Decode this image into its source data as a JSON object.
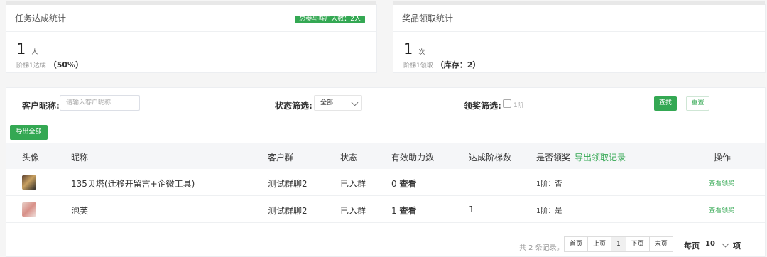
{
  "task_card": {
    "title": "任务达成统计",
    "badge": "总参与客户人数：2人",
    "count": "1",
    "unit": "人",
    "sub_label": "阶梯1达成",
    "sub_value": "（50%）"
  },
  "reward_card": {
    "title": "奖品领取统计",
    "count": "1",
    "unit": "次",
    "sub_label": "阶梯1领取",
    "sub_value": "（库存：2）"
  },
  "filters": {
    "nickname_label": "客户昵称:",
    "nickname_placeholder": "请输入客户昵称",
    "status_label": "状态筛选:",
    "status_value": "全部",
    "reward_label": "领奖筛选:",
    "reward_option": "1阶",
    "search_button": "查找",
    "reset_button": "重置"
  },
  "export_all_button": "导出全部",
  "table": {
    "headers": {
      "avatar": "头像",
      "nickname": "昵称",
      "group": "客户群",
      "status": "状态",
      "help_count": "有效助力数",
      "tier": "达成阶梯数",
      "reward": "是否领奖",
      "export_reward": "导出领取记录",
      "action": "操作"
    },
    "rows": [
      {
        "nickname": "135贝塔(迁移开留言+企微工具)",
        "group": "测试群聊2",
        "status": "已入群",
        "help_count": "0",
        "view_label": "查看",
        "tier": "",
        "reward": "1阶：否",
        "action": "查看领奖"
      },
      {
        "nickname": "泡芙",
        "group": "测试群聊2",
        "status": "已入群",
        "help_count": "1",
        "view_label": "查看",
        "tier": "1",
        "reward": "1阶：是",
        "action": "查看领奖"
      }
    ]
  },
  "pagination": {
    "total": "共 2 条记录。",
    "first": "首页",
    "prev": "上页",
    "current": "1",
    "next": "下页",
    "last": "末页",
    "per_page_label": "每页",
    "per_page_value": "10",
    "per_page_unit": "项"
  }
}
